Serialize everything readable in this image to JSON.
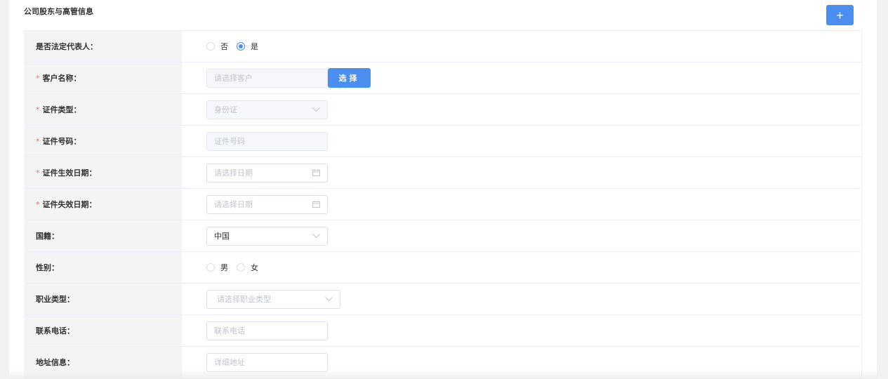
{
  "section": {
    "title": "公司股东与高管信息",
    "add_label": "+"
  },
  "rows": {
    "legal_rep": {
      "label": "是否法定代表人：",
      "options": [
        "否",
        "是"
      ],
      "selected": "是"
    },
    "customer_name": {
      "label": "客户名称：",
      "required": "*",
      "placeholder": "请选择客户",
      "button": "选择"
    },
    "id_type": {
      "label": "证件类型：",
      "required": "*",
      "value": "身份证"
    },
    "id_number": {
      "label": "证件号码：",
      "required": "*",
      "placeholder": "证件号码"
    },
    "id_start_date": {
      "label": "证件生效日期：",
      "required": "*",
      "placeholder": "请选择日期"
    },
    "id_end_date": {
      "label": "证件失效日期：",
      "required": "*",
      "placeholder": "请选择日期"
    },
    "nationality": {
      "label": "国籍：",
      "value": "中国"
    },
    "gender": {
      "label": "性别：",
      "options": [
        "男",
        "女"
      ]
    },
    "occupation": {
      "label": "职业类型：",
      "placeholder": "请选择职业类型"
    },
    "phone": {
      "label": "联系电话：",
      "placeholder": "联系电话"
    },
    "address": {
      "label": "地址信息：",
      "placeholder": "详细地址"
    }
  },
  "colors": {
    "primary": "#4a8ff0",
    "required": "#f56c6c",
    "label_bg": "#f4f4f5",
    "border": "#ebeef5"
  }
}
